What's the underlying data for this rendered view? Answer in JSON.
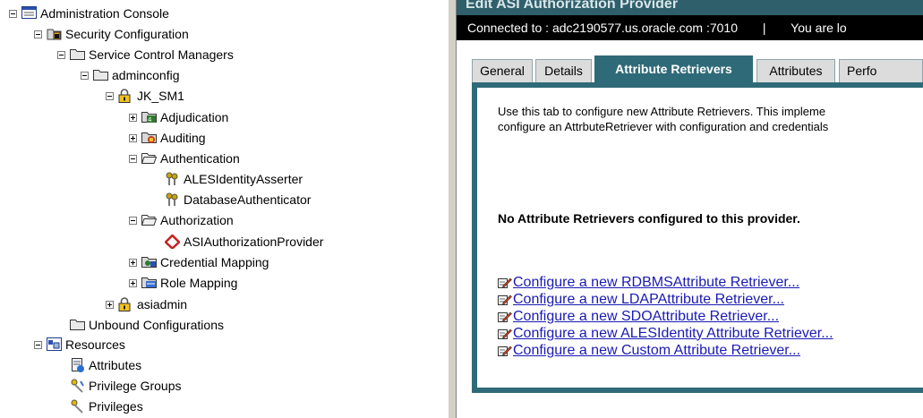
{
  "tree": {
    "items": [
      {
        "label": "Administration Console",
        "toggle": "minus",
        "icon": "console-icon"
      },
      {
        "label": "Security Configuration",
        "toggle": "minus",
        "icon": "security-config-icon"
      },
      {
        "label": "Service Control Managers",
        "toggle": "minus",
        "icon": "folder-icon"
      },
      {
        "label": "adminconfig",
        "toggle": "minus",
        "icon": "folder-icon"
      },
      {
        "label": "JK_SM1",
        "toggle": "minus",
        "icon": "lock-icon"
      },
      {
        "label": "Adjudication",
        "toggle": "plus",
        "icon": "adjudication-icon"
      },
      {
        "label": "Auditing",
        "toggle": "plus",
        "icon": "auditing-icon"
      },
      {
        "label": "Authentication",
        "toggle": "minus",
        "icon": "folder-open-icon"
      },
      {
        "label": "ALESIdentityAsserter",
        "toggle": "none",
        "icon": "keys-icon"
      },
      {
        "label": "DatabaseAuthenticator",
        "toggle": "none",
        "icon": "keys-icon"
      },
      {
        "label": "Authorization",
        "toggle": "minus",
        "icon": "folder-open-icon"
      },
      {
        "label": "ASIAuthorizationProvider",
        "toggle": "none",
        "icon": "provider-icon"
      },
      {
        "label": "Credential Mapping",
        "toggle": "plus",
        "icon": "credential-icon"
      },
      {
        "label": "Role Mapping",
        "toggle": "plus",
        "icon": "role-icon"
      },
      {
        "label": "asiadmin",
        "toggle": "plus",
        "icon": "lock-icon"
      },
      {
        "label": "Unbound Configurations",
        "toggle": "none",
        "icon": "folder-icon"
      },
      {
        "label": "Resources",
        "toggle": "minus",
        "icon": "resources-icon"
      },
      {
        "label": "Attributes",
        "toggle": "none",
        "icon": "attributes-icon"
      },
      {
        "label": "Privilege Groups",
        "toggle": "none",
        "icon": "privilege-groups-icon"
      },
      {
        "label": "Privileges",
        "toggle": "none",
        "icon": "privileges-icon"
      }
    ]
  },
  "header": {
    "title": "Edit ASI Authorization Provider",
    "connected_label": "Connected to :",
    "connected_host": "adc2190577.us.oracle.com :7010",
    "separator": "|",
    "user_text": "You are lo"
  },
  "tabs": [
    {
      "label": "General",
      "active": false
    },
    {
      "label": "Details",
      "active": false
    },
    {
      "label": "Attribute Retrievers",
      "active": true
    },
    {
      "label": "Attributes",
      "active": false
    },
    {
      "label": "Perfo",
      "active": false
    }
  ],
  "panel": {
    "description_line1": "Use this tab to configure new Attribute Retrievers. This impleme",
    "description_line2": "configure an AttrbuteRetriever with configuration and credentials",
    "empty_message": "No Attribute Retrievers configured to this provider.",
    "links": [
      "Configure a new RDBMSAttribute Retriever...",
      "Configure a new LDAPAttribute Retriever...",
      "Configure a new SDOAttribute Retriever...",
      "Configure a new ALESIdentity Attribute Retriever...",
      "Configure a new Custom Attribute Retriever..."
    ]
  },
  "colors": {
    "panel_teal": "#2f6a78",
    "link_blue": "#1a1ab5",
    "connection_bar": "#000000"
  }
}
